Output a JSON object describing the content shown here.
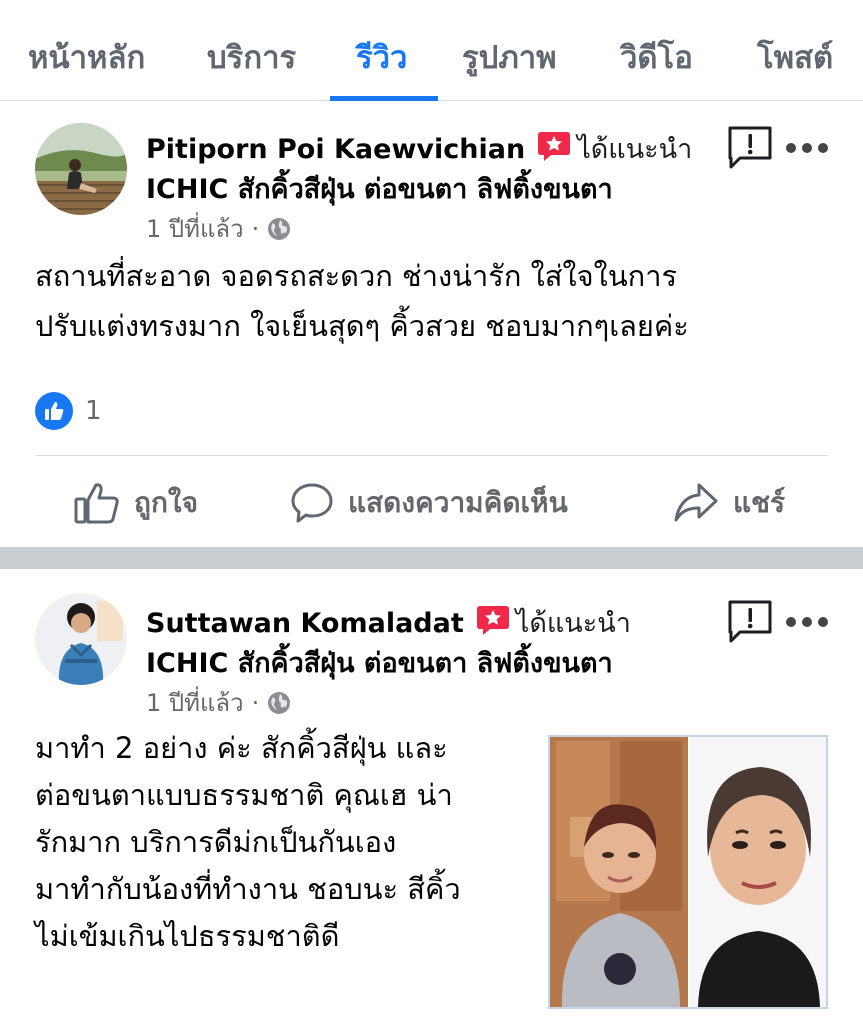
{
  "tabs": [
    {
      "label": "หน้าหลัก"
    },
    {
      "label": "บริการ"
    },
    {
      "label": "รีวิว"
    },
    {
      "label": "รูปภาพ"
    },
    {
      "label": "วิดีโอ"
    },
    {
      "label": "โพสต์"
    }
  ],
  "accent_color": "#1877f2",
  "reviews": [
    {
      "author": "Pitiporn Poi Kaewvichian",
      "recommend_text": "ได้แนะนำ",
      "page_name": "ICHIC สักคิ้วสีฝุ่น ต่อขนตา ลิฟติ้งขนตา",
      "time": "1 ปีที่แล้ว",
      "separator": "·",
      "body_lines": [
        "สถานที่สะอาด จอดรถสะดวก ช่างน่ารัก ใส่ใจในการ",
        "ปรับแต่งทรงมาก ใจเย็นสุดๆ คิ้วสวย ชอบมากๆเลยค่ะ"
      ],
      "like_count": "1"
    },
    {
      "author": "Suttawan Komaladat",
      "recommend_text": "ได้แนะนำ",
      "page_name": "ICHIC สักคิ้วสีฝุ่น ต่อขนตา ลิฟติ้งขนตา",
      "time": "1 ปีที่แล้ว",
      "separator": "·",
      "body_lines": [
        "มาทำ 2 อย่าง ค่ะ สักคิ้วสีฝุ่น และ",
        "ต่อขนตาแบบธรรมชาติ คุณเฮ น่า",
        "รักมาก บริการดีม่กเป็นกันเอง",
        "มาทำกับน้องที่ทำงาน  ชอบนะ สีคิ้ว",
        "ไม่เข้มเกินไปธรรมชาติดี"
      ]
    }
  ],
  "actions": {
    "like": "ถูกใจ",
    "comment": "แสดงความคิดเห็น",
    "share": "แชร์"
  },
  "icons": [
    "recommend-badge-icon",
    "globe-icon",
    "report-icon",
    "more-icon",
    "like-icon",
    "comment-icon",
    "share-icon"
  ]
}
